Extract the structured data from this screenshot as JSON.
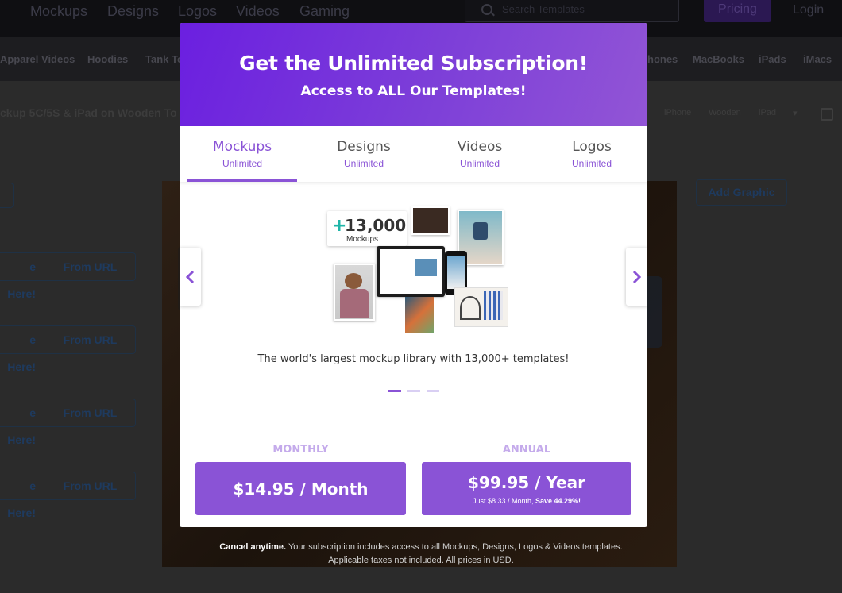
{
  "topnav": {
    "links": [
      "Mockups",
      "Designs",
      "Logos",
      "Videos",
      "Gaming"
    ],
    "search_placeholder": "Search Templates",
    "pricing": "Pricing",
    "login": "Login"
  },
  "catbar": {
    "items": [
      "Apparel Videos",
      "Hoodies",
      "Tank To",
      "hones",
      "MacBooks",
      "iPads",
      "iMacs"
    ]
  },
  "page": {
    "title": "ckup 5C/5S & iPad on Wooden To",
    "tags": [
      "iPhone",
      "Wooden",
      "iPad"
    ],
    "upload_rows": [
      {
        "left": "e Here!",
        "right": "From URL"
      },
      {
        "left": "e Here!",
        "right": "From URL"
      },
      {
        "left": "e Here!",
        "right": "From URL"
      },
      {
        "left": "e Here!",
        "right": "From URL"
      }
    ],
    "add_graphic": "Add Graphic"
  },
  "modal": {
    "title": "Get the Unlimited Subscription!",
    "subtitle": "Access to ALL Our Templates!",
    "tabs": [
      {
        "label": "Mockups",
        "sub": "Unlimited",
        "active": true
      },
      {
        "label": "Designs",
        "sub": "Unlimited",
        "active": false
      },
      {
        "label": "Videos",
        "sub": "Unlimited",
        "active": false
      },
      {
        "label": "Logos",
        "sub": "Unlimited",
        "active": false
      }
    ],
    "collage": {
      "count": "13,000",
      "plus": "+",
      "count_label": "Mockups"
    },
    "description": "The world's largest mockup library with 13,000+ templates!",
    "carousel": {
      "slides": 3,
      "active": 0
    },
    "plans": {
      "monthly_label": "MONTHLY",
      "monthly_price": "$14.95 / Month",
      "annual_label": "ANNUAL",
      "annual_price": "$99.95 / Year",
      "annual_note": "Just $8.33 / Month,",
      "annual_save": "Save 44.29%!"
    }
  },
  "footnote": {
    "bold": "Cancel anytime.",
    "line1": "Your subscription includes access to all Mockups, Designs, Logos & Videos templates.",
    "line2": "Applicable taxes not included. All prices in USD."
  },
  "colors": {
    "accent": "#8a53d6",
    "header_gradient_start": "#6b1fe0",
    "header_gradient_end": "#9255d6",
    "overlay_dark": "#1d1d20"
  }
}
